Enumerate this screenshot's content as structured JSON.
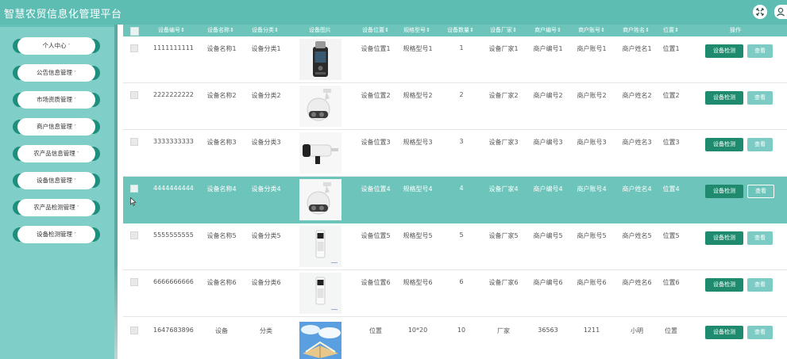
{
  "header": {
    "title": "智慧农贸信息化管理平台",
    "fullscreen_icon": "expand-icon",
    "user_icon": "user-icon"
  },
  "sidebar": {
    "items": [
      {
        "label": "个人中心"
      },
      {
        "label": "公告信息管理"
      },
      {
        "label": "市场资质管理"
      },
      {
        "label": "商户信息管理"
      },
      {
        "label": "农产品信息管理"
      },
      {
        "label": "设备信息管理"
      },
      {
        "label": "农产品检测管理"
      },
      {
        "label": "设备检测管理"
      }
    ],
    "caret": "˅"
  },
  "table": {
    "columns": [
      "设备编号",
      "设备名称",
      "设备分类",
      "设备图片",
      "设备位置",
      "规格型号",
      "设备数量",
      "设备厂家",
      "商户编号",
      "商户账号",
      "商户姓名",
      "位置",
      "操作"
    ],
    "sortable_suffix": "⇕",
    "rows": [
      {
        "id": "1111111111",
        "name": "设备名称1",
        "category": "设备分类1",
        "image": "handheld-detector",
        "location": "设备位置1",
        "model": "规格型号1",
        "qty": "1",
        "maker": "设备厂家1",
        "merchant_no": "商户编号1",
        "merchant_acct": "商户账号1",
        "merchant_name": "商户姓名1",
        "position": "位置1",
        "action_check": "设备检测",
        "action_view": "查看"
      },
      {
        "id": "2222222222",
        "name": "设备名称2",
        "category": "设备分类2",
        "image": "dome-camera",
        "location": "设备位置2",
        "model": "规格型号2",
        "qty": "2",
        "maker": "设备厂家2",
        "merchant_no": "商户编号2",
        "merchant_acct": "商户账号2",
        "merchant_name": "商户姓名2",
        "position": "位置2",
        "action_check": "设备检测",
        "action_view": "查看"
      },
      {
        "id": "3333333333",
        "name": "设备名称3",
        "category": "设备分类3",
        "image": "bullet-camera",
        "location": "设备位置3",
        "model": "规格型号3",
        "qty": "3",
        "maker": "设备厂家3",
        "merchant_no": "商户编号3",
        "merchant_acct": "商户账号3",
        "merchant_name": "商户姓名3",
        "position": "位置3",
        "action_check": "设备检测",
        "action_view": "查看"
      },
      {
        "id": "4444444444",
        "name": "设备名称4",
        "category": "设备分类4",
        "image": "dome-camera",
        "location": "设备位置4",
        "model": "规格型号4",
        "qty": "4",
        "maker": "设备厂家4",
        "merchant_no": "商户编号4",
        "merchant_acct": "商户账号4",
        "merchant_name": "商户姓名4",
        "position": "位置4",
        "action_check": "设备检测",
        "action_view": "查看"
      },
      {
        "id": "5555555555",
        "name": "设备名称5",
        "category": "设备分类5",
        "image": "handheld-scanner",
        "location": "设备位置5",
        "model": "规格型号5",
        "qty": "5",
        "maker": "设备厂家5",
        "merchant_no": "商户编号5",
        "merchant_acct": "商户账号5",
        "merchant_name": "商户姓名5",
        "position": "位置5",
        "action_check": "设备检测",
        "action_view": "查看"
      },
      {
        "id": "6666666666",
        "name": "设备名称6",
        "category": "设备分类6",
        "image": "handheld-scanner",
        "location": "设备位置6",
        "model": "规格型号6",
        "qty": "6",
        "maker": "设备厂家6",
        "merchant_no": "商户编号6",
        "merchant_acct": "商户账号6",
        "merchant_name": "商户姓名6",
        "position": "位置6",
        "action_check": "设备检测",
        "action_view": "查看"
      },
      {
        "id": "1647683896",
        "name": "设备",
        "category": "分类",
        "image": "book-sky",
        "location": "位置",
        "model": "10*20",
        "qty": "10",
        "maker": "厂家",
        "merchant_no": "36563",
        "merchant_acct": "1211",
        "merchant_name": "小明",
        "position": "位置",
        "action_check": "设备检测",
        "action_view": "查看"
      }
    ],
    "active_row": 3
  },
  "colors": {
    "accent": "#5dbdb3",
    "primary_button": "#1f8a6e",
    "secondary_button": "#7cccc5"
  }
}
